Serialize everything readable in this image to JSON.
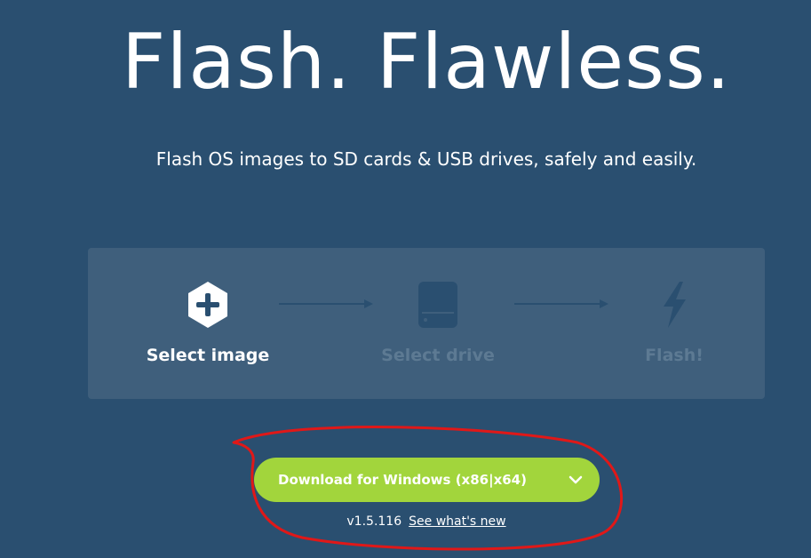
{
  "hero": {
    "title": "Flash. Flawless.",
    "subtitle": "Flash OS images to SD cards & USB drives, safely and easily."
  },
  "steps": [
    {
      "label": "Select image",
      "icon": "plus-hexagon-icon",
      "state": "active"
    },
    {
      "label": "Select drive",
      "icon": "drive-icon",
      "state": "inactive"
    },
    {
      "label": "Flash!",
      "icon": "lightning-icon",
      "state": "inactive"
    }
  ],
  "download": {
    "label": "Download for Windows (x86|x64)",
    "version": "v1.5.116",
    "whats_new": "See what's new"
  },
  "colors": {
    "background": "#2a4f70",
    "panel": "#3f5f7c",
    "accent_green": "#a2d53c",
    "inactive": "#5d7a93",
    "annotation": "#e01818"
  }
}
